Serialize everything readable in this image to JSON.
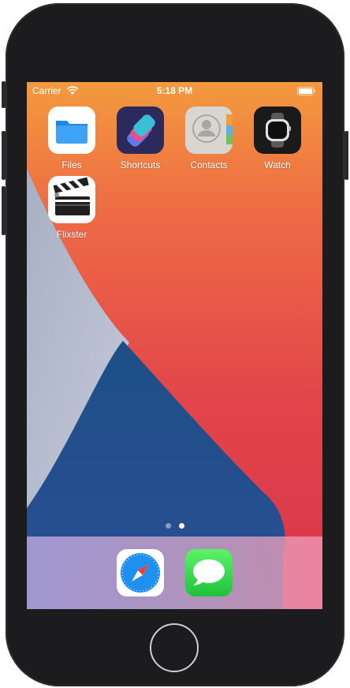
{
  "statusbar": {
    "carrier": "Carrier",
    "time": "5:18 PM"
  },
  "home": {
    "apps": [
      {
        "label": "Files",
        "icon": "files-icon"
      },
      {
        "label": "Shortcuts",
        "icon": "shortcuts-icon"
      },
      {
        "label": "Contacts",
        "icon": "contacts-icon"
      },
      {
        "label": "Watch",
        "icon": "watch-icon"
      },
      {
        "label": "Flixster",
        "icon": "clapperboard-icon"
      }
    ],
    "pages": {
      "count": 2,
      "current": 2
    }
  },
  "dock": {
    "apps": [
      {
        "icon": "safari-icon"
      },
      {
        "icon": "messages-icon"
      }
    ]
  },
  "colors": {
    "bezel": "#1c1c1e",
    "wallpaper_orange": "#e8564a",
    "wallpaper_blue": "#1f4f86"
  }
}
